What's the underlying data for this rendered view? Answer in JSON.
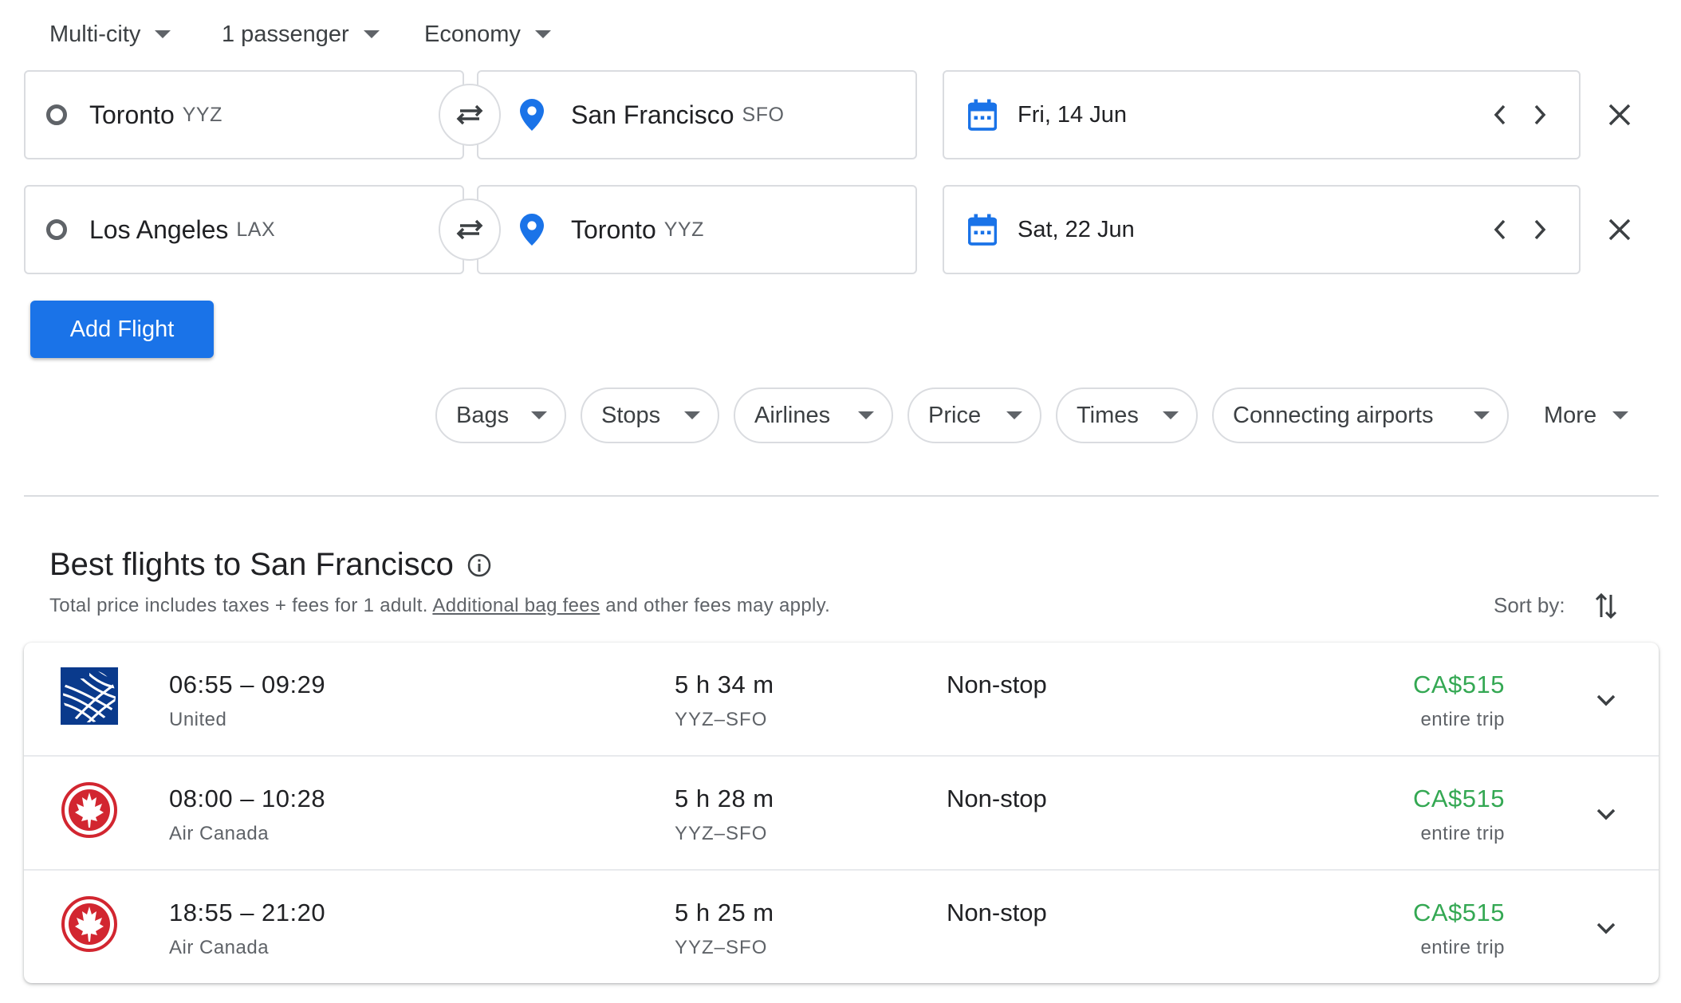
{
  "top_selectors": {
    "trip_type": "Multi-city",
    "passengers": "1 passenger",
    "cabin": "Economy"
  },
  "legs": [
    {
      "origin_city": "Toronto",
      "origin_code": "YYZ",
      "dest_city": "San Francisco",
      "dest_code": "SFO",
      "date": "Fri, 14 Jun"
    },
    {
      "origin_city": "Los Angeles",
      "origin_code": "LAX",
      "dest_city": "Toronto",
      "dest_code": "YYZ",
      "date": "Sat, 22 Jun"
    }
  ],
  "add_flight_label": "Add Flight",
  "filters": [
    "Bags",
    "Stops",
    "Airlines",
    "Price",
    "Times",
    "Connecting airports",
    "More"
  ],
  "results": {
    "title": "Best flights to San Francisco",
    "subtitle_pre": "Total price includes taxes + fees for 1 adult.",
    "subtitle_link": "Additional bag fees",
    "subtitle_post": "and other fees may apply.",
    "sort_label": "Sort by:",
    "flights": [
      {
        "times": "06:55 – 09:29",
        "airline": "United",
        "duration": "5 h 34 m",
        "route": "YYZ–SFO",
        "stops": "Non-stop",
        "price": "CA$515",
        "price_note": "entire trip",
        "logo": "united-globe-icon"
      },
      {
        "times": "08:00 – 10:28",
        "airline": "Air Canada",
        "duration": "5 h 28 m",
        "route": "YYZ–SFO",
        "stops": "Non-stop",
        "price": "CA$515",
        "price_note": "entire trip",
        "logo": "air-canada-maple-leaf-icon"
      },
      {
        "times": "18:55 – 21:20",
        "airline": "Air Canada",
        "duration": "5 h 25 m",
        "route": "YYZ–SFO",
        "stops": "Non-stop",
        "price": "CA$515",
        "price_note": "entire trip",
        "logo": "air-canada-maple-leaf-icon"
      }
    ]
  },
  "colors": {
    "accent_blue": "#1a73e8",
    "price_green": "#34a853",
    "air_canada_red": "#d22630",
    "united_blue": "#0a3a8c"
  }
}
